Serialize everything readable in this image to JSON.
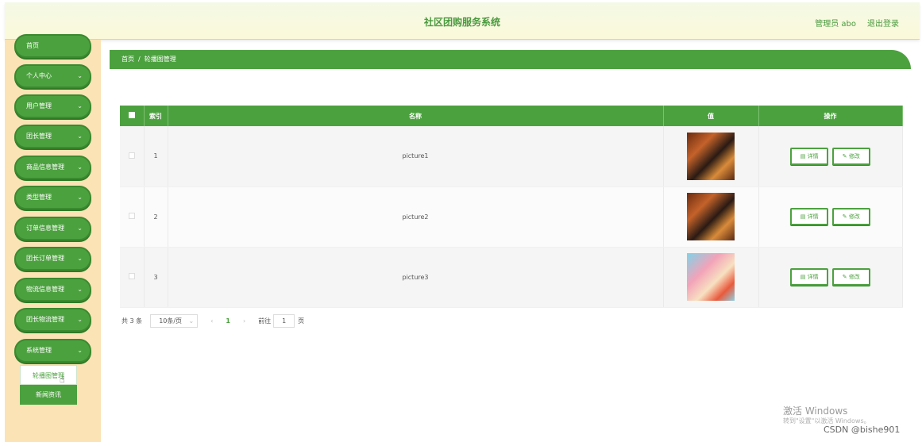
{
  "header": {
    "title": "社区团购服务系统",
    "user_label": "管理员 abo",
    "logout_label": "退出登录"
  },
  "sidebar": {
    "items": [
      {
        "label": "首页"
      },
      {
        "label": "个人中心"
      },
      {
        "label": "用户管理"
      },
      {
        "label": "团长管理"
      },
      {
        "label": "商品信息管理"
      },
      {
        "label": "类型管理"
      },
      {
        "label": "订单信息管理"
      },
      {
        "label": "团长订单管理"
      },
      {
        "label": "物流信息管理"
      },
      {
        "label": "团长物流管理"
      },
      {
        "label": "系统管理"
      }
    ],
    "submenu": [
      {
        "label": "轮播图管理",
        "active": true
      },
      {
        "label": "新闻资讯",
        "active": false
      }
    ]
  },
  "breadcrumb": {
    "home": "首页",
    "separator": "/",
    "current": "轮播图管理"
  },
  "table": {
    "headers": [
      "索引",
      "名称",
      "值",
      "操作"
    ],
    "rows": [
      {
        "index": "1",
        "name": "picture1",
        "image": "food-photo"
      },
      {
        "index": "2",
        "name": "picture2",
        "image": "food-photo"
      },
      {
        "index": "3",
        "name": "picture3",
        "image": "colorful-food-photo"
      }
    ],
    "detail_label": "详情",
    "edit_label": "修改"
  },
  "pagination": {
    "total_text": "共 3 条",
    "page_size": "10条/页",
    "current_page": "1",
    "goto_label": "前往",
    "goto_value": "1",
    "page_unit": "页"
  },
  "watermark": {
    "line1": "激活 Windows",
    "line2": "转到\"设置\"以激活 Windows。",
    "credit": "CSDN @bishe901"
  },
  "colors": {
    "primary": "#4ca13f",
    "sidebar_bg": "#fbe3b5",
    "header_bg": "#f7f9e0"
  }
}
